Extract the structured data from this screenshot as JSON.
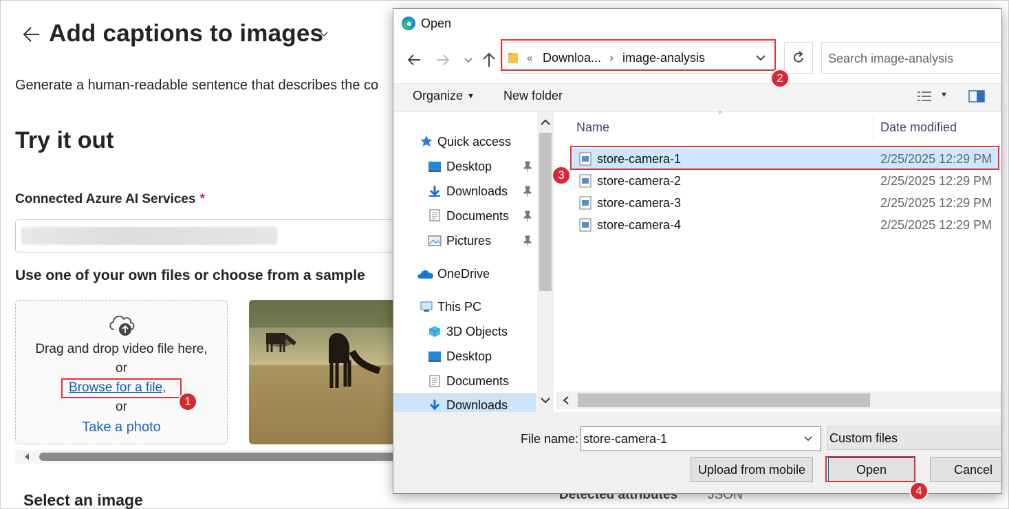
{
  "page": {
    "title": "Add captions to images",
    "description": "Generate a human-readable sentence that describes the co",
    "try_heading": "Try it out",
    "services_label": "Connected Azure AI Services",
    "required_mark": "*",
    "use_files_label": "Use one of your own files or choose from a sample",
    "drop_text": "Drag and drop video file here,",
    "or_1": "or",
    "browse_link": "Browse for a file,",
    "or_2": "or",
    "take_photo": "Take a photo",
    "select_image": "Select an image",
    "tab_detected": "Detected attributes",
    "tab_json": "JSON"
  },
  "dialog": {
    "title": "Open",
    "address": {
      "sep1": "«",
      "crumb1": "Downloa...",
      "sep2": "›",
      "crumb2": "image-analysis"
    },
    "search_placeholder": "Search image-analysis",
    "toolbar": {
      "organize": "Organize",
      "new_folder": "New folder"
    },
    "nav": {
      "quick_access": "Quick access",
      "qa_items": [
        "Desktop",
        "Downloads",
        "Documents",
        "Pictures"
      ],
      "onedrive": "OneDrive",
      "this_pc": "This PC",
      "pc_items": [
        "3D Objects",
        "Desktop",
        "Documents",
        "Downloads"
      ]
    },
    "columns": {
      "name": "Name",
      "date": "Date modified"
    },
    "files": [
      {
        "name": "store-camera-1",
        "date": "2/25/2025 12:29 PM"
      },
      {
        "name": "store-camera-2",
        "date": "2/25/2025 12:29 PM"
      },
      {
        "name": "store-camera-3",
        "date": "2/25/2025 12:29 PM"
      },
      {
        "name": "store-camera-4",
        "date": "2/25/2025 12:29 PM"
      }
    ],
    "file_name_label": "File name:",
    "file_name_value": "store-camera-1",
    "filter_value": "Custom files",
    "upload_button": "Upload from mobile",
    "open_button": "Open",
    "cancel_button": "Cancel"
  },
  "annotations": [
    "1",
    "2",
    "3",
    "4"
  ],
  "colors": {
    "accent_red": "#d9282f",
    "link_blue": "#0f5fa8",
    "selection_blue": "#cce8ff"
  }
}
